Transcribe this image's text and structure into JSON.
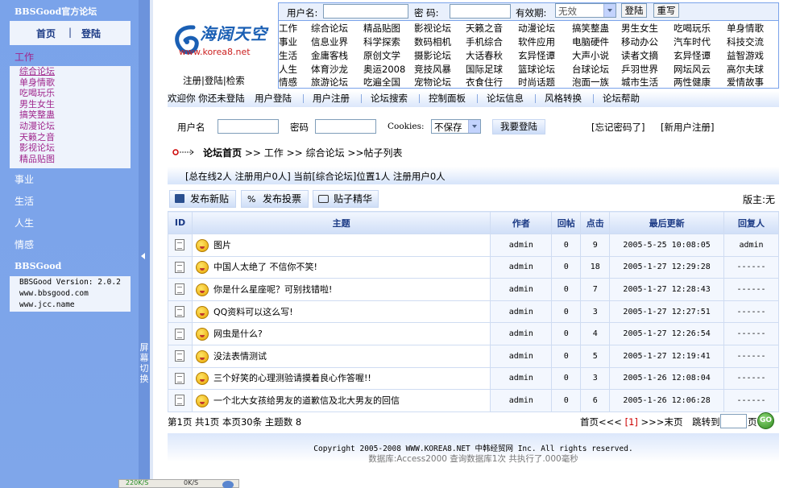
{
  "sidebar": {
    "title": "BBSGood官方论坛",
    "home": "首页",
    "divider": "|",
    "login": "登陆",
    "categories": [
      {
        "label": "工作"
      },
      {
        "label": "事业"
      },
      {
        "label": "生活"
      },
      {
        "label": "人生"
      },
      {
        "label": "情感"
      }
    ],
    "work_subitems": [
      "综合论坛",
      "单身情歌",
      "吃喝玩乐",
      "男生女生",
      "搞笑整蛊",
      "动漫论坛",
      "天籁之音",
      "影视论坛",
      "精品贴图"
    ],
    "bbsgood_title": "BBSGood",
    "info_lines": [
      "BBSGood Version: 2.0.2",
      "www.bbsgood.com",
      "www.jcc.name"
    ],
    "splitter_text": "屏幕切换"
  },
  "logo": {
    "text": "海阔天空",
    "url": "www.korea8.net"
  },
  "top_links": [
    "注册",
    "登陆",
    "检索"
  ],
  "login_bar": {
    "username_label": "用户名:",
    "password_label": "密 码:",
    "validity_label": "有效期:",
    "validity_value": "无效",
    "login_button": "登陆",
    "rewrite_button": "重写"
  },
  "forum_rows": [
    {
      "head": "工作",
      "items": [
        "综合论坛",
        "精品贴图",
        "影视论坛",
        "天籁之音",
        "动漫论坛",
        "搞笑整蛊",
        "男生女生",
        "吃喝玩乐",
        "单身情歌"
      ]
    },
    {
      "head": "事业",
      "items": [
        "信息业界",
        "科学探索",
        "数码相机",
        "手机综合",
        "软件应用",
        "电脑硬件",
        "移动办公",
        "汽车时代",
        "科技交流"
      ]
    },
    {
      "head": "生活",
      "items": [
        "金庸客栈",
        "原创文学",
        "摄影论坛",
        "大话春秋",
        "玄异怪谭",
        "大声小说",
        "读者文摘",
        "玄异怪谭",
        "益智游戏"
      ]
    },
    {
      "head": "人生",
      "items": [
        "体育沙龙",
        "奥运2008",
        "竞技风暴",
        "国际足球",
        "篮球论坛",
        "台球论坛",
        "乒羽世界",
        "网坛风云",
        "高尔夫球"
      ]
    },
    {
      "head": "情感",
      "items": [
        "旅游论坛",
        "吃遍全国",
        "宠物论坛",
        "衣食住行",
        "时尚话题",
        "泡面一族",
        "城市生活",
        "两性健康",
        "爱情故事"
      ]
    }
  ],
  "menu": {
    "welcome": "欢迎你 你还未登陆",
    "items": [
      "用户登陆",
      "用户注册",
      "论坛搜索",
      "控制面板",
      "论坛信息",
      "风格转换",
      "论坛帮助"
    ]
  },
  "login_form": {
    "username_label": "用户名",
    "password_label": "密码",
    "cookies_label": "Cookies:",
    "cookies_value": "不保存",
    "submit": "我要登陆",
    "forgot": "[忘记密码了]",
    "register": "[新用户注册]"
  },
  "breadcrumb": {
    "home": "论坛首页",
    "sep": ">>",
    "level1": "工作",
    "level2": "综合论坛",
    "level3": ">>帖子列表"
  },
  "online_status": "[总在线2人 注册用户0人] 当前[综合论坛]位置1人 注册用户0人",
  "toolbar": {
    "new_post": "发布新贴",
    "new_poll": "发布投票",
    "digest": "贴子精华",
    "moderator": "版主:无"
  },
  "table": {
    "headers": [
      "ID",
      "主题",
      "作者",
      "回帖",
      "点击",
      "最后更新",
      "回复人"
    ],
    "rows": [
      {
        "title": "图片",
        "author": "admin",
        "replies": "0",
        "clicks": "9",
        "updated": "2005-5-25 10:08:05",
        "replier": "admin"
      },
      {
        "title": "中国人太绝了 不信你不笑!",
        "author": "admin",
        "replies": "0",
        "clicks": "18",
        "updated": "2005-1-27 12:29:28",
        "replier": "------"
      },
      {
        "title": "你是什么星座呢？可别找错啦!",
        "author": "admin",
        "replies": "0",
        "clicks": "7",
        "updated": "2005-1-27 12:28:43",
        "replier": "------"
      },
      {
        "title": "QQ资料可以这么写!",
        "author": "admin",
        "replies": "0",
        "clicks": "3",
        "updated": "2005-1-27 12:27:51",
        "replier": "------"
      },
      {
        "title": "网虫是什么?",
        "author": "admin",
        "replies": "0",
        "clicks": "4",
        "updated": "2005-1-27 12:26:54",
        "replier": "------"
      },
      {
        "title": "没法表情测试",
        "author": "admin",
        "replies": "0",
        "clicks": "5",
        "updated": "2005-1-27 12:19:41",
        "replier": "------"
      },
      {
        "title": "三个好笑的心理测验请摸着良心作答喔!!",
        "author": "admin",
        "replies": "0",
        "clicks": "3",
        "updated": "2005-1-26 12:08:04",
        "replier": "------"
      },
      {
        "title": "一个北大女孩给男友的道歉信及北大男友的回信",
        "author": "admin",
        "replies": "0",
        "clicks": "6",
        "updated": "2005-1-26 12:06:28",
        "replier": "------"
      }
    ]
  },
  "pagination": {
    "summary": "第1页 共1页 本页30条 主题数 8",
    "first": "首页<<<",
    "current": "[1]",
    "last": ">>>末页",
    "jump_label": "跳转到第",
    "page_unit": "页",
    "go": "GO"
  },
  "footer": {
    "copyright": "Copyright 2005-2008 WWW.KOREA8.NET 中韩经贸网 Inc. All rights reserved.",
    "db_info": "数据库:Access2000 查询数据库1次 共执行了.000毫秒"
  },
  "taskbar": {
    "down": "220K/S",
    "up": "0K/S"
  },
  "colors": {
    "sidebar": "#7aa3ea",
    "header_text": "#1b3a85",
    "link_purple": "#a0268c"
  }
}
